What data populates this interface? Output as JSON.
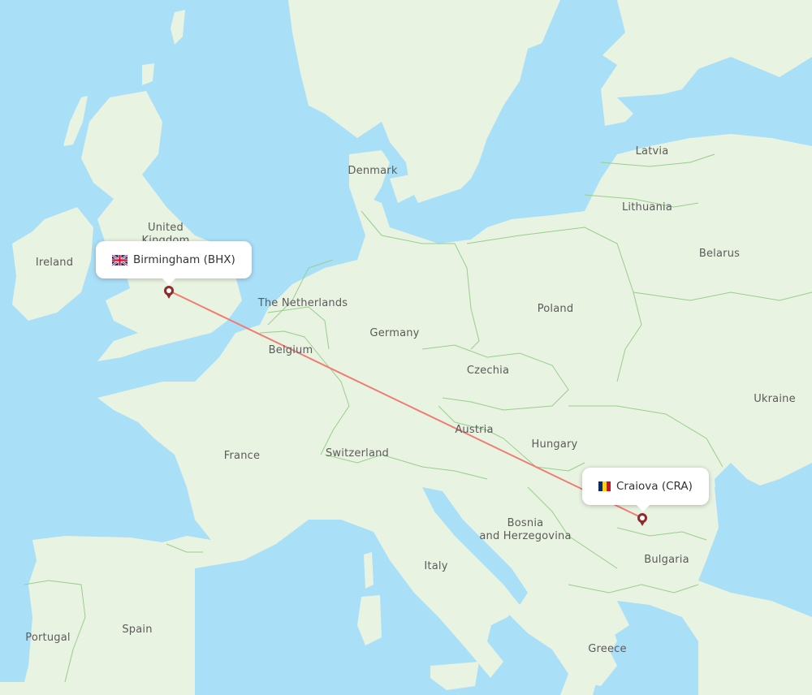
{
  "map": {
    "type": "flight-route-map",
    "colors": {
      "water": "#aadff8",
      "land": "#e9f3e1",
      "border": "#96cf8c",
      "route": "#f07b73",
      "marker": "#8e2b2b",
      "label": "#5b5b5b"
    },
    "origin": {
      "city": "Birmingham (BHX)",
      "flag": "united-kingdom-flag-icon",
      "marker": "origin-marker-icon"
    },
    "destination": {
      "city": "Craiova (CRA)",
      "flag": "romania-flag-icon",
      "marker": "destination-marker-icon"
    },
    "country_labels": [
      {
        "id": "ireland",
        "text": "Ireland"
      },
      {
        "id": "united-kingdom",
        "text": "United\nKingdom"
      },
      {
        "id": "denmark",
        "text": "Denmark"
      },
      {
        "id": "the-netherlands",
        "text": "The Netherlands"
      },
      {
        "id": "germany",
        "text": "Germany"
      },
      {
        "id": "belgium",
        "text": "Belgium"
      },
      {
        "id": "poland",
        "text": "Poland"
      },
      {
        "id": "latvia",
        "text": "Latvia"
      },
      {
        "id": "lithuania",
        "text": "Lithuania"
      },
      {
        "id": "belarus",
        "text": "Belarus"
      },
      {
        "id": "czechia",
        "text": "Czechia"
      },
      {
        "id": "ukraine",
        "text": "Ukraine"
      },
      {
        "id": "austria",
        "text": "Austria"
      },
      {
        "id": "hungary",
        "text": "Hungary"
      },
      {
        "id": "france",
        "text": "France"
      },
      {
        "id": "switzerland",
        "text": "Switzerland"
      },
      {
        "id": "bosnia",
        "text": "Bosnia\nand Herzegovina"
      },
      {
        "id": "bulgaria",
        "text": "Bulgaria"
      },
      {
        "id": "italy",
        "text": "Italy"
      },
      {
        "id": "spain",
        "text": "Spain"
      },
      {
        "id": "portugal",
        "text": "Portugal"
      },
      {
        "id": "greece",
        "text": "Greece"
      }
    ]
  }
}
